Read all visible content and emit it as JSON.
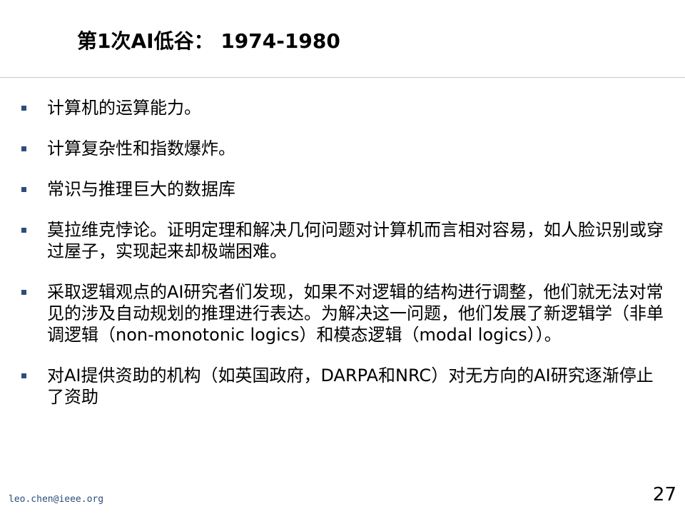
{
  "slide": {
    "title": "第1次AI低谷： 1974-1980",
    "bullets": [
      "计算机的运算能力。",
      "计算复杂性和指数爆炸。",
      "常识与推理巨大的数据库",
      "莫拉维克悖论。证明定理和解决几何问题对计算机而言相对容易，如人脸识别或穿过屋子，实现起来却极端困难。",
      "采取逻辑观点的AI研究者们发现，如果不对逻辑的结构进行调整，他们就无法对常见的涉及自动规划的推理进行表达。为解决这一问题，他们发展了新逻辑学（非单调逻辑（non-monotonic logics）和模态逻辑（modal logics））。",
      "对AI提供资助的机构（如英国政府，DARPA和NRC）对无方向的AI研究逐渐停止了资助"
    ],
    "bullet_color": "#2e4d7b"
  },
  "footer": {
    "email": "leo.chen@ieee.org",
    "page_number": "27"
  }
}
